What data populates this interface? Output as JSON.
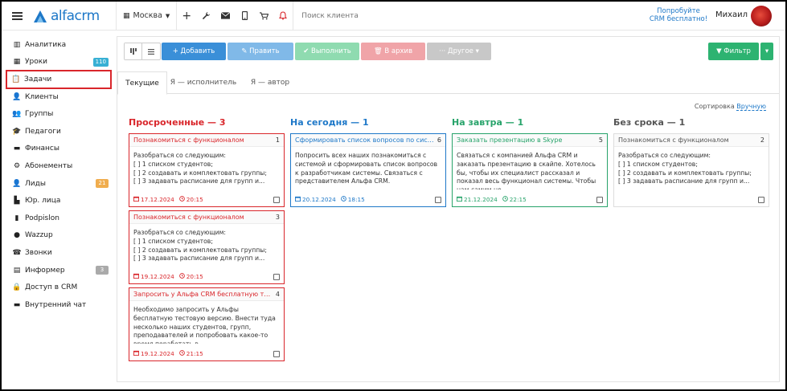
{
  "colors": {
    "accent": "#1e78c8",
    "overdue": "#d9262b",
    "today": "#1e78c8",
    "tomorrow": "#27a36a",
    "nodate": "#555555",
    "badge_blue": "#38b0d4",
    "badge_orange": "#f0ad4e",
    "badge_gray": "#aaaaaa"
  },
  "header": {
    "logo_text": "alfacrm",
    "city": "Москва",
    "search_placeholder": "Поиск клиента",
    "promo_line1": "Попробуйте",
    "promo_line2": "CRM бесплатно!",
    "user_name": "Михаил"
  },
  "sidebar": {
    "items": [
      {
        "label": "Аналитика",
        "icon": "columns-icon",
        "glyph": "▥"
      },
      {
        "label": "Уроки",
        "icon": "calendar-icon",
        "glyph": "▦",
        "badge": "110",
        "badge_color": "#38b0d4"
      },
      {
        "label": "Задачи",
        "icon": "clipboard-icon",
        "glyph": "📋",
        "active": true
      },
      {
        "label": "Клиенты",
        "icon": "user-icon",
        "glyph": "👤"
      },
      {
        "label": "Группы",
        "icon": "users-icon",
        "glyph": "👥"
      },
      {
        "label": "Педагоги",
        "icon": "graduation-cap-icon",
        "glyph": "🎓"
      },
      {
        "label": "Финансы",
        "icon": "money-icon",
        "glyph": "▬"
      },
      {
        "label": "Абонементы",
        "icon": "gear-icon",
        "glyph": "⚙"
      },
      {
        "label": "Лиды",
        "icon": "user-plus-icon",
        "glyph": "👤",
        "badge": "21",
        "badge_color": "#f0ad4e"
      },
      {
        "label": "Юр. лица",
        "icon": "building-icon",
        "glyph": "▙"
      },
      {
        "label": "Podpislon",
        "icon": "file-icon",
        "glyph": "▮"
      },
      {
        "label": "Wazzup",
        "icon": "whatsapp-icon",
        "glyph": "●"
      },
      {
        "label": "Звонки",
        "icon": "phone-icon",
        "glyph": "☎"
      },
      {
        "label": "Информер",
        "icon": "list-icon",
        "glyph": "▤",
        "badge": "3",
        "badge_color": "#aaaaaa"
      },
      {
        "label": "Доступ в CRM",
        "icon": "lock-icon",
        "glyph": "🔒"
      },
      {
        "label": "Внутренний чат",
        "icon": "chat-icon",
        "glyph": "▬"
      }
    ]
  },
  "toolbar": {
    "add_label": "+ Добавить",
    "edit_label": "✎ Править",
    "done_label": "✔ Выполнить",
    "archive_label": "🗑 В архив",
    "other_label": "··· Другое ▾",
    "filter_label": "▼ Фильтр",
    "filter_drop": "▾"
  },
  "tabs": [
    {
      "label": "Текущие",
      "active": true
    },
    {
      "label": "Я — исполнитель"
    },
    {
      "label": "Я — автор"
    }
  ],
  "sort": {
    "label": "Сортировка",
    "value": "Вручную"
  },
  "columns": [
    {
      "title": "Просроченные — 3",
      "color": "#d9262b",
      "cards": [
        {
          "title": "Познакомиться с функционалом",
          "num": "1",
          "body": "Разобраться со следующим:\n[ ] 1 списком студентов;\n[ ] 2 создавать и комплектовать группы;\n[ ] 3 задавать расписание для групп и...",
          "date": "17.12.2024",
          "time": "20:15"
        },
        {
          "title": "Познакомиться с функционалом",
          "num": "3",
          "body": "Разобраться со следующим:\n[ ] 1 списком студентов;\n[ ] 2 создавать и комплектовать группы;\n[ ] 3 задавать расписание для групп и...",
          "date": "19.12.2024",
          "time": "20:15"
        },
        {
          "title": "Запросить у Альфа CRM бесплатную тестово...",
          "num": "4",
          "body": "Необходимо запросить у Альфы бесплатную тестовую версию. Внести туда несколько наших студентов, групп, преподавателей и попробовать какое-то время поработать в...",
          "date": "19.12.2024",
          "time": "21:15"
        }
      ]
    },
    {
      "title": "На сегодня — 1",
      "color": "#1e78c8",
      "cards": [
        {
          "title": "Сформировать список вопросов по системе",
          "num": "6",
          "body": "Попросить всех наших познакомиться с системой и сформировать список вопросов к разработчикам системы. Связаться с представителем Альфа CRM.",
          "date": "20.12.2024",
          "time": "18:15"
        }
      ]
    },
    {
      "title": "На завтра — 1",
      "color": "#27a36a",
      "cards": [
        {
          "title": "Заказать презентацию в Skype",
          "num": "5",
          "body": "Связаться с компанией Альфа CRM и заказать презентацию в скайпе. Хотелось бы, чтобы их специалист рассказал и показал весь функционал системы. Чтобы нам самим не...",
          "date": "21.12.2024",
          "time": "22:15"
        }
      ]
    },
    {
      "title": "Без срока — 1",
      "color": "#555555",
      "cards": [
        {
          "title": "Познакомиться с функционалом",
          "num": "2",
          "body": "Разобраться со следующим:\n[ ] 1 списком студентов;\n[ ] 2 создавать и комплектовать группы;\n[ ] 3 задавать расписание для групп и...",
          "date": "",
          "time": ""
        }
      ]
    }
  ]
}
